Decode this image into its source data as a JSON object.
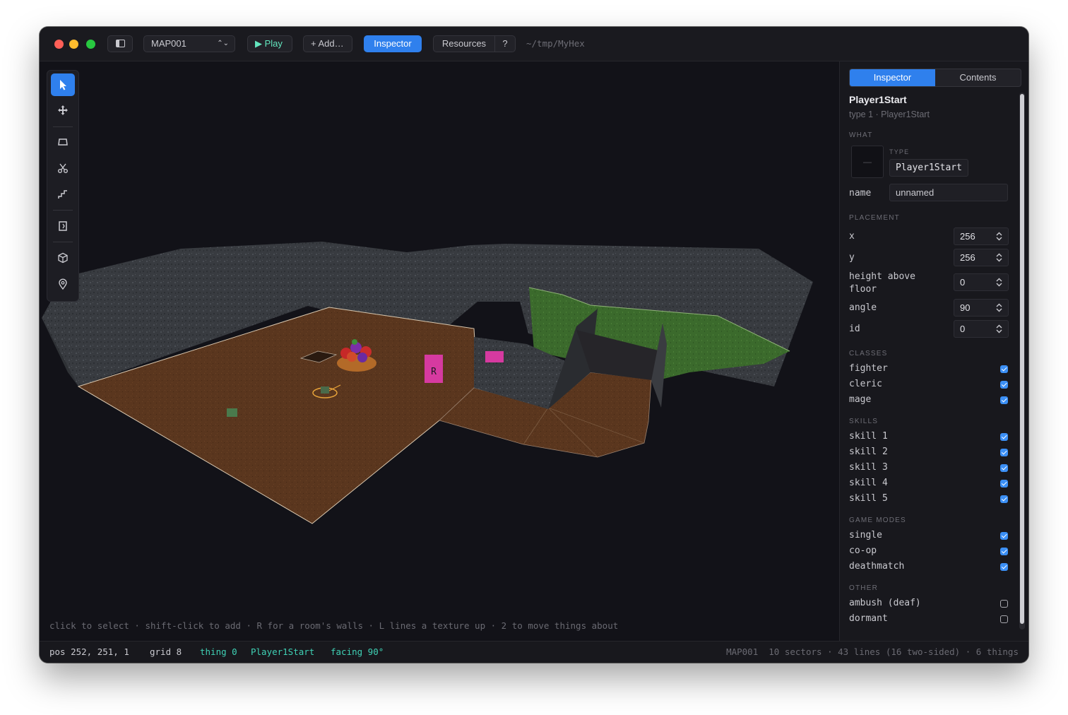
{
  "titlebar": {
    "map_select": "MAP001",
    "play_label": "▶ Play",
    "add_label": "+ Add…",
    "inspector_label": "Inspector",
    "resources_label": "Resources",
    "help_label": "?",
    "path": "~/tmp/MyHex"
  },
  "viewport": {
    "tools": [
      "select",
      "move",
      "draw-sector",
      "split",
      "stairs",
      "door",
      "3d-view",
      "place-thing"
    ],
    "active_tool": "select",
    "sign_text": "R",
    "hint": "click to select · shift-click to add · R for a room's walls · L lines a texture up · 2 to move things about"
  },
  "statusbar": {
    "pos": "pos 252, 251, 1",
    "grid": "grid 8",
    "thing": "thing 0",
    "thing_type": "Player1Start",
    "facing": "facing 90°",
    "summary": "MAP001  10 sectors · 43 lines (16 two-sided) · 6 things"
  },
  "panel": {
    "tabs": [
      "Inspector",
      "Contents"
    ],
    "active_tab": "Inspector",
    "title": "Player1Start",
    "subtitle": "type 1 · Player1Start",
    "what": {
      "section": "WHAT",
      "thumb": "—",
      "type_label": "TYPE",
      "type_value": "Player1Start",
      "name_label": "name",
      "name_value": "unnamed"
    },
    "placement": {
      "section": "PLACEMENT",
      "x_label": "x",
      "x_value": "256",
      "y_label": "y",
      "y_value": "256",
      "height_label": "height above floor",
      "height_value": "0",
      "angle_label": "angle",
      "angle_value": "90",
      "id_label": "id",
      "id_value": "0"
    },
    "classes": {
      "section": "CLASSES",
      "items": [
        {
          "label": "fighter",
          "checked": true
        },
        {
          "label": "cleric",
          "checked": true
        },
        {
          "label": "mage",
          "checked": true
        }
      ]
    },
    "skills": {
      "section": "SKILLS",
      "items": [
        {
          "label": "skill 1",
          "checked": true
        },
        {
          "label": "skill 2",
          "checked": true
        },
        {
          "label": "skill 3",
          "checked": true
        },
        {
          "label": "skill 4",
          "checked": true
        },
        {
          "label": "skill 5",
          "checked": true
        }
      ]
    },
    "game_modes": {
      "section": "GAME MODES",
      "items": [
        {
          "label": "single",
          "checked": true
        },
        {
          "label": "co-op",
          "checked": true
        },
        {
          "label": "deathmatch",
          "checked": true
        }
      ]
    },
    "other": {
      "section": "OTHER",
      "items": [
        {
          "label": "ambush (deaf)",
          "checked": false
        },
        {
          "label": "dormant",
          "checked": false
        }
      ]
    }
  },
  "colors": {
    "accent": "#2f80ed",
    "teal": "#3fd1b5",
    "checkbox": "#3b8ff5",
    "floor": "#5a361e",
    "grass": "#3b6a2c",
    "wall": "#3a3d42",
    "marker": "#d63aa0"
  }
}
